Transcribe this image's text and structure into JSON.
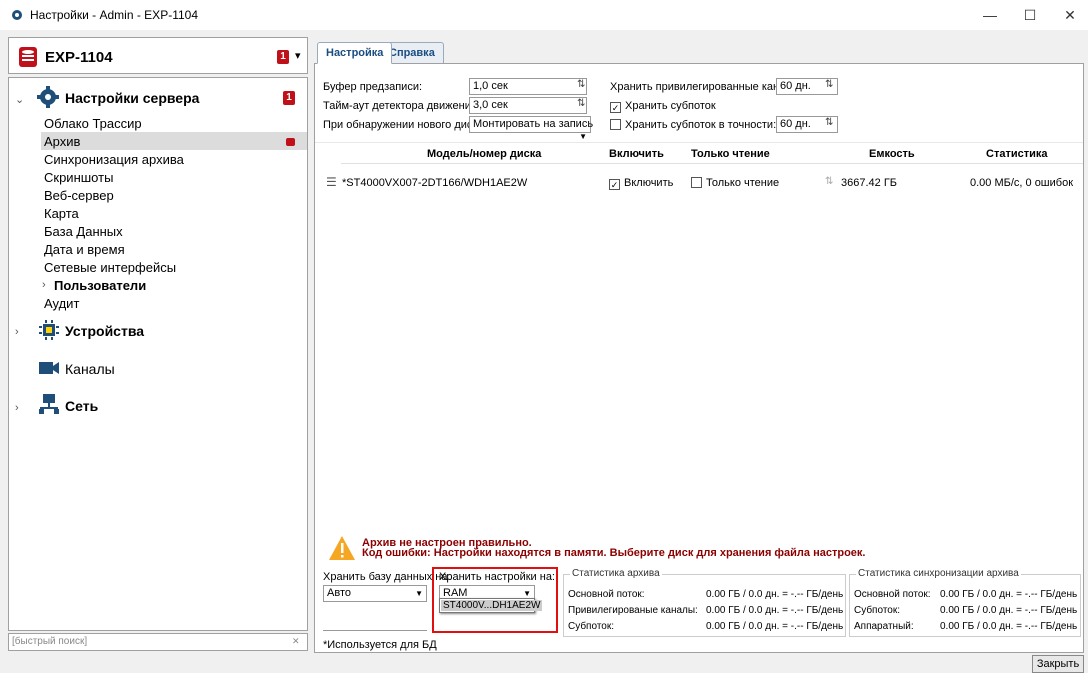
{
  "window": {
    "title": "Настройки - Admin - EXP-1104",
    "minimize": "—",
    "maximize": "☐",
    "close": "✕"
  },
  "device": {
    "name": "EXP-1104",
    "badge": "1",
    "dropdown": "▾"
  },
  "tree": {
    "server_settings": {
      "label": "Настройки сервера",
      "badge": "1"
    },
    "items": [
      {
        "label": "Облако Трассир"
      },
      {
        "label": "Архив",
        "selected": true
      },
      {
        "label": "Синхронизация архива"
      },
      {
        "label": "Скриншоты"
      },
      {
        "label": "Веб-сервер"
      },
      {
        "label": "Карта"
      },
      {
        "label": "База Данных"
      },
      {
        "label": "Дата и время"
      },
      {
        "label": "Сетевые интерфейсы"
      },
      {
        "label": "Пользователи"
      },
      {
        "label": "Аудит"
      }
    ],
    "devices": "Устройства",
    "channels": "Каналы",
    "network": "Сеть"
  },
  "search": {
    "placeholder": "[быстрый поиск]",
    "clear": "✕"
  },
  "tabs": [
    "Настройка",
    "Справка"
  ],
  "settings": {
    "prebuffer_label": "Буфер предзаписи:",
    "prebuffer_value": "1,0 сек",
    "motion_timeout_label": "Тайм-аут детектора движения:",
    "motion_timeout_value": "3,0 сек",
    "new_disk_label": "При обнаружении нового диска:",
    "new_disk_value": "Монтировать на запись",
    "keep_priv_label": "Хранить привилегированные каналы:",
    "keep_priv_value": "60 дн.",
    "keep_substream_label": "Хранить субпоток",
    "keep_substream_checked": true,
    "keep_substream_exact_label": "Хранить субпоток в точности:",
    "keep_substream_exact_checked": false,
    "keep_substream_exact_value": "60 дн."
  },
  "disk_table": {
    "headers": [
      "Модель/номер диска",
      "Включить",
      "Только чтение",
      "Емкость",
      "Статистика"
    ],
    "rows": [
      {
        "model": "*ST4000VX007-2DT166/WDH1AE2W",
        "enable_label": "Включить",
        "enable": true,
        "readonly_label": "Только чтение",
        "readonly": false,
        "capacity": "3667.42 ГБ",
        "stats": "0.00 МБ/с, 0 ошибок"
      }
    ]
  },
  "warning": {
    "line1": "Архив не настроен правильно.",
    "line2": "Код ошибки: Настройки находятся в памяти. Выберите диск для хранения файла настроек."
  },
  "storage": {
    "db_label": "Хранить базу данных на:",
    "db_value": "Авто",
    "settings_label": "Хранить настройки на:",
    "settings_value": "RAM",
    "settings_option": "ST4000V...DH1AE2W",
    "db_note": "*Используется для БД"
  },
  "archive_stats": {
    "title": "Статистика архива",
    "rows": [
      {
        "label": "Основной поток:",
        "value": "0.00 ГБ / 0.0 дн. = -.-- ГБ/день"
      },
      {
        "label": "Привилегированые каналы:",
        "value": "0.00 ГБ / 0.0 дн. = -.-- ГБ/день"
      },
      {
        "label": "Субпоток:",
        "value": "0.00 ГБ / 0.0 дн. = -.-- ГБ/день"
      }
    ]
  },
  "sync_stats": {
    "title": "Статистика синхронизации архива",
    "rows": [
      {
        "label": "Основной поток:",
        "value": "0.00 ГБ / 0.0 дн. = -.-- ГБ/день"
      },
      {
        "label": "Субпоток:",
        "value": "0.00 ГБ / 0.0 дн. = -.-- ГБ/день"
      },
      {
        "label": "Аппаратный:",
        "value": "0.00 ГБ / 0.0 дн. = -.-- ГБ/день"
      }
    ]
  },
  "footer": {
    "close_label": "Закрыть"
  }
}
